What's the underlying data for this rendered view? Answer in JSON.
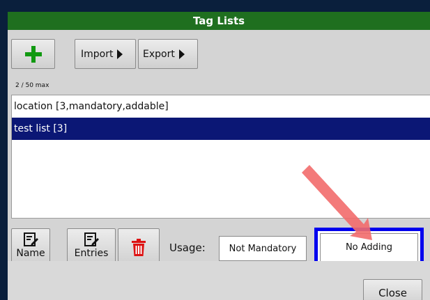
{
  "window": {
    "title": "Tag Lists"
  },
  "toolbar": {
    "add_icon": "plus-icon",
    "import_label": "Import",
    "export_label": "Export",
    "count_text": "2 / 50 max"
  },
  "list": {
    "items": [
      {
        "label": "location [3,mandatory,addable]",
        "selected": false
      },
      {
        "label": "test list [3]",
        "selected": true
      }
    ]
  },
  "actions": {
    "name_label": "Name",
    "entries_label": "Entries",
    "delete_icon": "trash-icon",
    "usage_label": "Usage:",
    "mandatory_value": "Not Mandatory",
    "adding_value": "No Adding"
  },
  "footer": {
    "close_label": "Close"
  },
  "colors": {
    "titlebar": "#1f6f1f",
    "selection": "#0b1775",
    "highlight_border": "#0000ee",
    "arrow": "#f26b6b",
    "add_icon": "#119911",
    "delete_icon": "#dd1111"
  }
}
